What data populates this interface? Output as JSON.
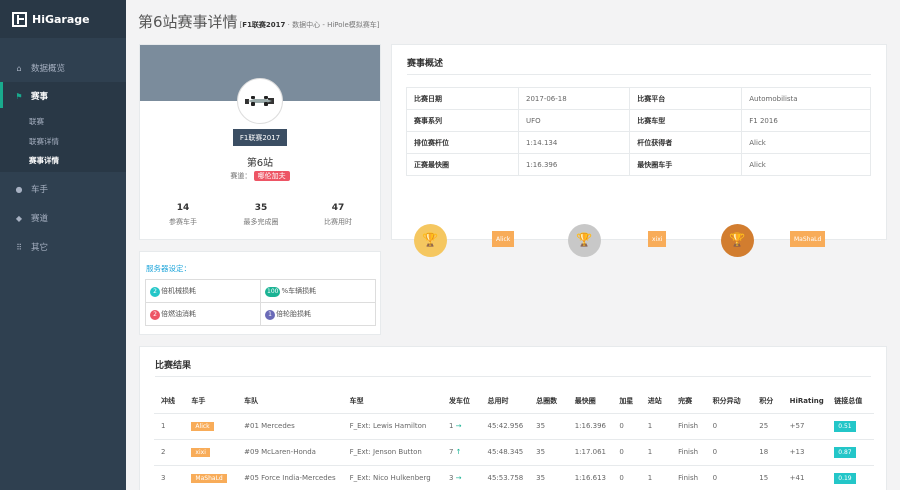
{
  "app": {
    "name": "HiGarage"
  },
  "nav": {
    "items": [
      {
        "label": "数据概览",
        "icon": "home-icon"
      },
      {
        "label": "赛事",
        "icon": "flag-icon"
      },
      {
        "label": "车手",
        "icon": "user-icon"
      },
      {
        "label": "赛道",
        "icon": "map-marker-icon"
      },
      {
        "label": "其它",
        "icon": "grid-icon"
      }
    ],
    "submenu": [
      "联赛",
      "联赛详情",
      "赛事详情"
    ]
  },
  "header": {
    "title": "第6站赛事详情",
    "crumb_bracket_open": "[",
    "crumb_league": "F1联赛2017",
    "crumb_rest": " · 数据中心 - HiPole模拟赛车",
    "crumb_bracket_close": "]"
  },
  "profile": {
    "league": "F1联赛2017",
    "station": "第6站",
    "track_label": "赛道：",
    "track_name": "哪伦加夫",
    "stats": [
      {
        "value": "14",
        "label": "参赛车手"
      },
      {
        "value": "35",
        "label": "最多完成圈"
      },
      {
        "value": "47",
        "label": "比赛用时"
      }
    ]
  },
  "server": {
    "title": "服务器设定：",
    "items": [
      {
        "badge": "2",
        "text": "倍机械损耗",
        "color": "#23c6c8"
      },
      {
        "badge": "100",
        "text": "%车辆损耗",
        "color": "#1ab394"
      },
      {
        "badge": "2",
        "text": "倍燃油消耗",
        "color": "#ed5565"
      },
      {
        "badge": "1",
        "text": "倍轮胎损耗",
        "color": "#6b6bb8"
      }
    ]
  },
  "overview": {
    "title": "赛事概述",
    "rows": [
      [
        "比赛日期",
        "2017-06-18",
        "比赛平台",
        "Automobilista"
      ],
      [
        "赛事系列",
        "UFO",
        "比赛车型",
        "F1 2016"
      ],
      [
        "排位赛杆位",
        "1:14.134",
        "杆位获得者",
        "Alick"
      ],
      [
        "正赛最快圈",
        "1:16.396",
        "最快圈车手",
        "Alick"
      ]
    ],
    "podium": [
      {
        "name": "Alick",
        "color": "#f5c760"
      },
      {
        "name": "xixi",
        "color": "#c8c8c8"
      },
      {
        "name": "MaShaLd",
        "color": "#d27d2f"
      }
    ]
  },
  "results": {
    "title": "比赛结果",
    "headers": [
      "冲线",
      "车手",
      "车队",
      "车型",
      "发车位",
      "总用时",
      "总圈数",
      "最快圈",
      "加星",
      "进站",
      "完赛",
      "积分异动",
      "积分",
      "HiRating",
      "链接总值"
    ],
    "rows": [
      [
        "1",
        "Alick",
        "#01 Mercedes",
        "F_Ext: Lewis Hamilton",
        "1",
        "→",
        "45:42.956",
        "35",
        "1:16.396",
        "0",
        "1",
        "Finish",
        "0",
        "25",
        "+57",
        "0.51"
      ],
      [
        "2",
        "xixi",
        "#09 McLaren-Honda",
        "F_Ext: Jenson Button",
        "7",
        "↑",
        "45:48.345",
        "35",
        "1:17.061",
        "0",
        "1",
        "Finish",
        "0",
        "18",
        "+13",
        "0.87"
      ],
      [
        "3",
        "MaShaLd",
        "#05 Force India-Mercedes",
        "F_Ext: Nico Hulkenberg",
        "3",
        "→",
        "45:53.758",
        "35",
        "1:16.613",
        "0",
        "1",
        "Finish",
        "0",
        "15",
        "+41",
        "0.19"
      ]
    ]
  }
}
